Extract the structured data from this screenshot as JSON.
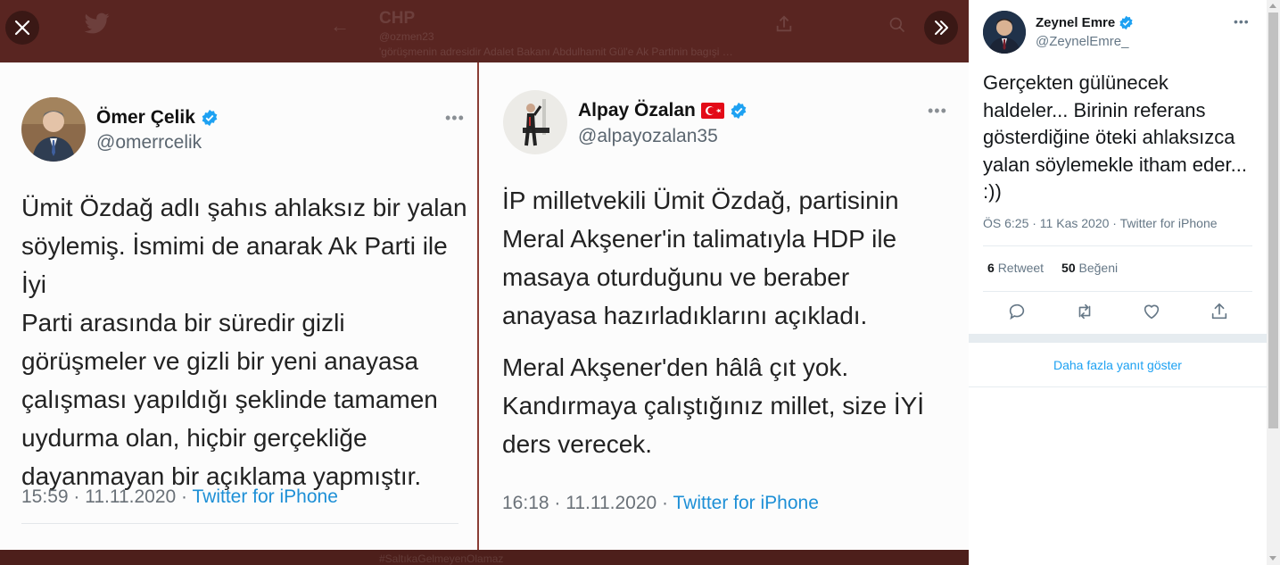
{
  "viewer": {
    "background_color": "#4d1f1b",
    "behind": {
      "name": "CHP",
      "handle": "@ozmen23",
      "tweet_line": "'görüşmenin adresidir Adalet Bakanı Abdulhamit Gül'e Ak Partinin bagışi …",
      "hashtag": "#SaltıkaGelmeyenOlamaz"
    },
    "close_icon": "close-icon",
    "expand_icon": "chevron-double-right-icon",
    "left_card": {
      "name": "Ömer Çelik",
      "handle": "@omerrcelik",
      "more": "•••",
      "text": "Ümit Özdağ adlı şahıs ahlaksız bir yalan\nsöylemiş. İsmimi de anarak Ak Parti ile İyi\nParti arasında bir süredir gizli\ngörüşmeler ve gizli bir yeni anayasa\nçalışması yapıldığı şeklinde tamamen\nuydurma olan, hiçbir gerçekliğe\ndayanmayan bir açıklama yapmıştır.",
      "time": "15:59 · 11.11.2020 · ",
      "source": "Twitter for iPhone"
    },
    "right_card": {
      "name": "Alpay Özalan",
      "handle": "@alpayozalan35",
      "more": "•••",
      "text_1": "İP milletvekili Ümit Özdağ, partisinin\nMeral Akşener'in talimatıyla HDP ile\nmasaya oturduğunu ve beraber\nanayasa hazırladıklarını açıkladı.",
      "text_2": "Meral Akşener'den hâlâ çıt yok.\nKandırmaya çalıştığınız millet, size İYİ\nders verecek.",
      "time": "16:18 · 11.11.2020 · ",
      "source": "Twitter for iPhone"
    }
  },
  "tweet": {
    "author_name": "Zeynel Emre",
    "author_handle": "@ZeynelEmre_",
    "more": "•••",
    "text": "Gerçekten gülünecek haldeler... Birinin referans gösterdiğine öteki ahlaksızca yalan söylemekle itham eder... :))",
    "meta": "ÖS 6:25 · 11 Kas 2020 · Twitter for iPhone",
    "retweets_count": "6",
    "retweets_label": "Retweet",
    "likes_count": "50",
    "likes_label": "Beğeni",
    "actions": [
      "reply-icon",
      "retweet-icon",
      "like-icon",
      "share-icon"
    ],
    "show_more": "Daha fazla yanıt göster"
  },
  "colors": {
    "link": "#1da1f2",
    "verified": "#1da1f2",
    "viewer_bg": "#4d1f1b"
  }
}
